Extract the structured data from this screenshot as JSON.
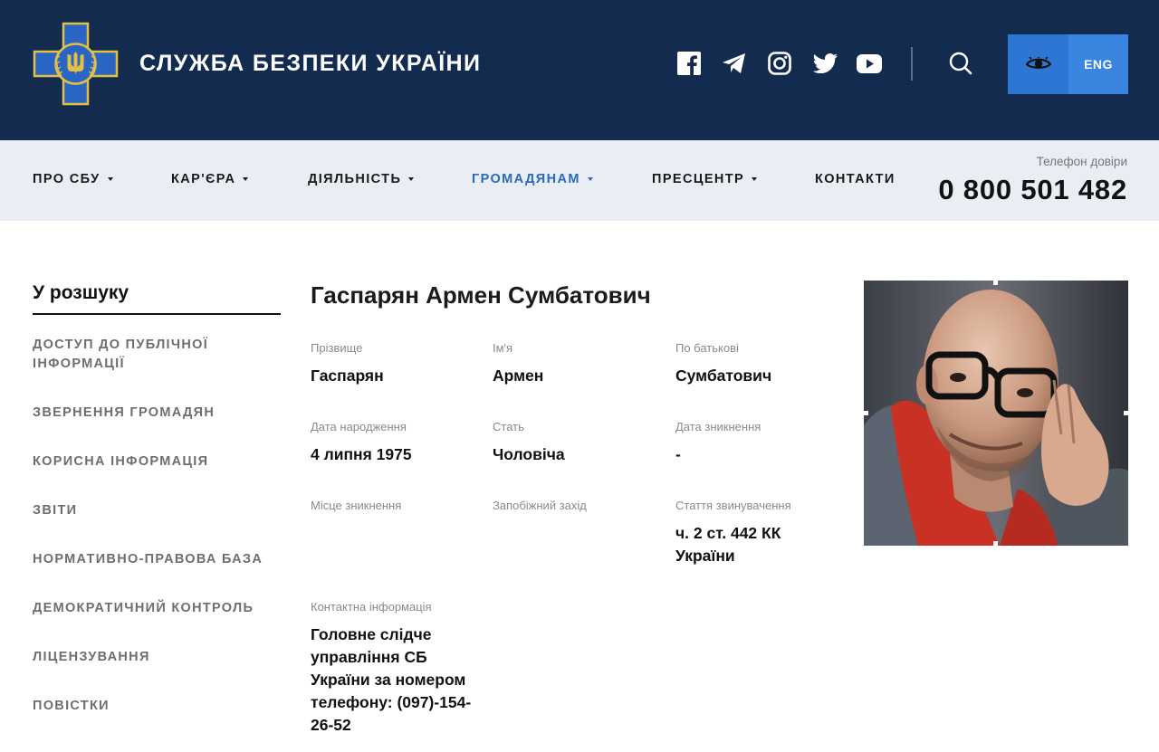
{
  "header": {
    "title": "СЛУЖБА БЕЗПЕКИ УКРАЇНИ",
    "social": [
      "facebook-icon",
      "telegram-icon",
      "instagram-icon",
      "twitter-icon",
      "youtube-icon"
    ],
    "lang_label": "ENG"
  },
  "nav": {
    "items": [
      {
        "label": "ПРО СБУ",
        "dropdown": true
      },
      {
        "label": "КАР'ЄРА",
        "dropdown": true
      },
      {
        "label": "ДІЯЛЬНІСТЬ",
        "dropdown": true
      },
      {
        "label": "ГРОМАДЯНАМ",
        "dropdown": true,
        "active": true
      },
      {
        "label": "ПРЕСЦЕНТР",
        "dropdown": true
      },
      {
        "label": "КОНТАКТИ",
        "dropdown": false
      }
    ],
    "hotline_label": "Телефон довіри",
    "hotline_number": "0 800 501 482"
  },
  "sidebar": {
    "title": "У розшуку",
    "items": [
      {
        "label": "ДОСТУП ДО ПУБЛІЧНОЇ ІНФОРМАЦІЇ"
      },
      {
        "label": "ЗВЕРНЕННЯ ГРОМАДЯН"
      },
      {
        "label": "КОРИСНА ІНФОРМАЦІЯ"
      },
      {
        "label": "ЗВІТИ"
      },
      {
        "label": "НОРМАТИВНО-ПРАВОВА БАЗА"
      },
      {
        "label": "ДЕМОКРАТИЧНИЙ КОНТРОЛЬ"
      },
      {
        "label": "ЛІЦЕНЗУВАННЯ"
      },
      {
        "label": "ПОВІСТКИ"
      }
    ]
  },
  "person": {
    "full_name": "Гаспарян Армен Сумбатович",
    "fields": [
      {
        "label": "Прізвище",
        "value": "Гаспарян"
      },
      {
        "label": "Ім'я",
        "value": "Армен"
      },
      {
        "label": "По батькові",
        "value": "Сумбатович"
      },
      {
        "label": "Дата народження",
        "value": "4 липня 1975"
      },
      {
        "label": "Стать",
        "value": "Чоловіча"
      },
      {
        "label": "Дата зникнення",
        "value": "-"
      },
      {
        "label": "Місце зникнення",
        "value": ""
      },
      {
        "label": "Запобіжний захід",
        "value": ""
      },
      {
        "label": "Стаття звинувачення",
        "value": "ч. 2 ст. 442 КК України"
      },
      {
        "label": "Контактна інформація",
        "value": "Головне слідче управління СБ України за номером телефону: (097)-154-26-52"
      }
    ]
  },
  "colors": {
    "header_bg": "#132b4f",
    "nav_bg": "#e9edf4",
    "accent": "#2d76d3",
    "active_nav": "#2a6ab9"
  }
}
